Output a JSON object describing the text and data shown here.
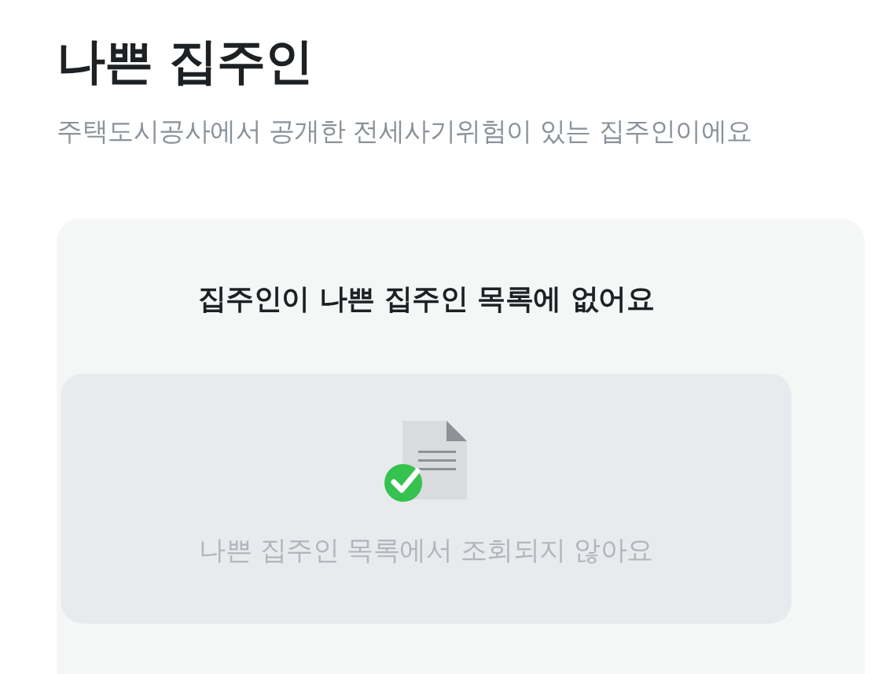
{
  "title": "나쁜 집주인",
  "subtitle": "주택도시공사에서 공개한 전세사기위험이 있는 집주인이에요",
  "result_card": {
    "heading": "집주인이 나쁜 집주인 목록에 없어요",
    "status": {
      "kind": "clear",
      "message": "나쁜 집주인 목록에서 조회되지 않아요"
    }
  }
}
